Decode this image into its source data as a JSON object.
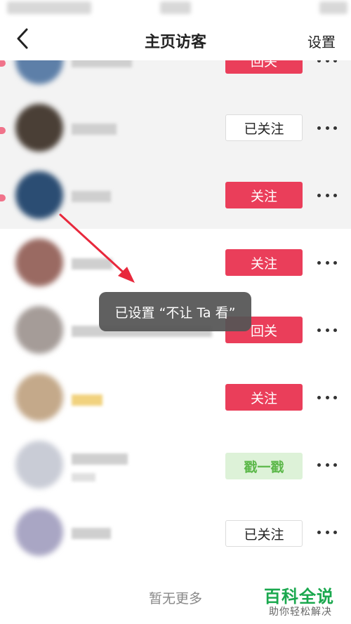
{
  "nav": {
    "back_icon": "chevron-left-icon",
    "title": "主页访客",
    "settings_label": "设置"
  },
  "rows": [
    {
      "button": "回关",
      "style": "red",
      "more_icon": "more-horizontal-icon"
    },
    {
      "button": "已关注",
      "style": "outline",
      "more_icon": "more-horizontal-icon"
    },
    {
      "button": "关注",
      "style": "red",
      "more_icon": "more-horizontal-icon"
    },
    {
      "button": "关注",
      "style": "red",
      "more_icon": "more-horizontal-icon"
    },
    {
      "button": "回关",
      "style": "red",
      "more_icon": "more-horizontal-icon"
    },
    {
      "button": "关注",
      "style": "red",
      "more_icon": "more-horizontal-icon"
    },
    {
      "button": "戳一戳",
      "style": "green",
      "more_icon": "more-horizontal-icon"
    },
    {
      "button": "已关注",
      "style": "outline",
      "more_icon": "more-horizontal-icon"
    }
  ],
  "toast": {
    "text": "已设置 “不让 Ta 看”"
  },
  "footer": {
    "text": "暂无更多"
  },
  "watermark": {
    "title": "百科全说",
    "subtitle": "助你轻松解决"
  },
  "colors": {
    "accent_red": "#ea3e5a",
    "poke_green": "#5cb84a",
    "annotation_arrow": "#e8283c"
  }
}
